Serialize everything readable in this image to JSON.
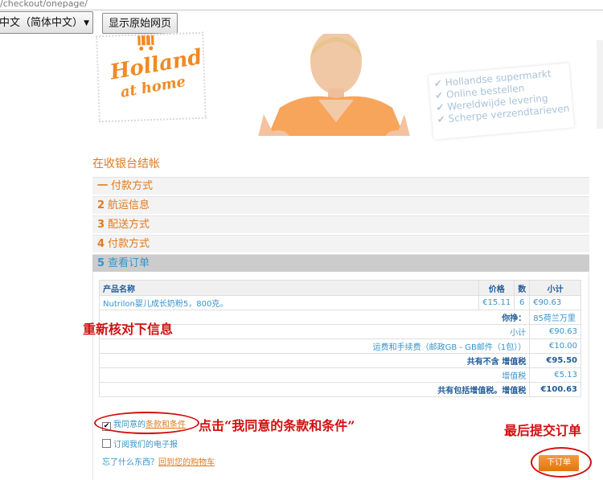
{
  "browser": {
    "url_fragment": "/checkout/onepage/",
    "language_select": "中文（简体中文）",
    "show_original_label": "显示原始网页"
  },
  "banner": {
    "logo_line1": "Holland",
    "logo_line2": "at home",
    "features": [
      "Hollandse supermarkt",
      "Online bestellen",
      "Wereldwijde levering",
      "Scherpe verzendtarieven"
    ]
  },
  "checkout": {
    "title": "在收银台结帐",
    "steps": [
      {
        "num": "一",
        "label": "付款方式"
      },
      {
        "num": "2",
        "label": "航运信息"
      },
      {
        "num": "3",
        "label": "配送方式"
      },
      {
        "num": "4",
        "label": "付款方式"
      },
      {
        "num": "5",
        "label": "查看订单"
      }
    ],
    "table": {
      "headers": {
        "name": "产品名称",
        "price": "价格",
        "qty": "数",
        "subtotal": "小计"
      },
      "item": {
        "name": "Nutrilon婴儿成长奶粉5，800克。",
        "price": "€15.11",
        "qty": "6",
        "subtotal": "€90.63"
      },
      "savings": {
        "label": "你挣：",
        "value": "85荷兰万里"
      },
      "rows": [
        {
          "label": "小计",
          "value": "€90.63"
        },
        {
          "label": "运费和手续费（邮政GB - GB邮件（1包））",
          "value": "€10.00"
        },
        {
          "label": "共有不含 增值税",
          "value": "€95.50"
        },
        {
          "label": "增值税",
          "value": "€5.13"
        },
        {
          "label": "共有包括增值税。增值税",
          "value": "€100.63"
        }
      ]
    },
    "agree_prefix": "我同意的",
    "agree_link": "条款和条件",
    "newsletter_label": "订阅我们的电子报",
    "forgot_prefix": "忘了什么东西？",
    "forgot_link": "回到您的购物车",
    "place_order_label": "下订单"
  },
  "annotations": {
    "verify": "重新核对下信息",
    "click_agree": "点击“我同意的条款和条件”",
    "submit": "最后提交订单"
  },
  "colors": {
    "accent": "#e07a1e",
    "link": "#3a93c8",
    "annotation": "#d20f0f"
  }
}
